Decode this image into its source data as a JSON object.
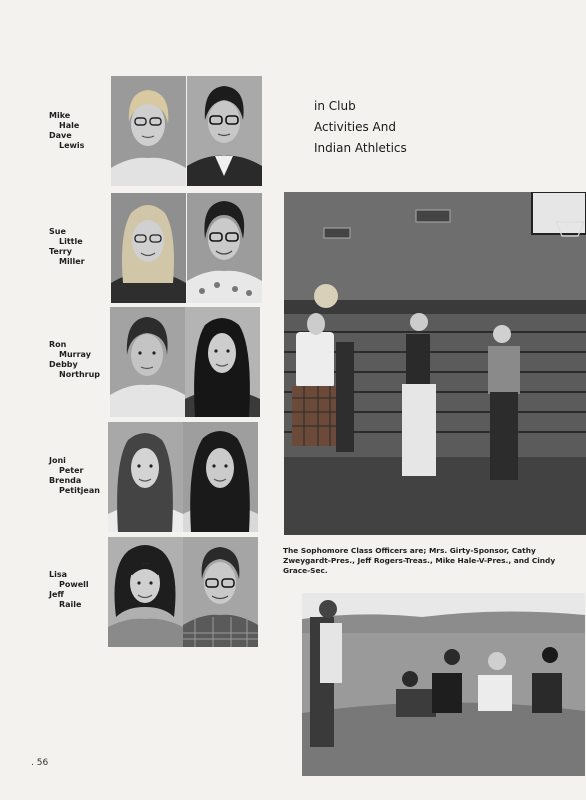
{
  "heading": {
    "line1": "in Club",
    "line2": "Activities And",
    "line3": "Indian Athletics"
  },
  "students": [
    {
      "row": 1,
      "first_a": "Mike",
      "last_a": "Hale",
      "first_b": "Dave",
      "last_b": "Lewis"
    },
    {
      "row": 2,
      "first_a": "Sue",
      "last_a": "Little",
      "first_b": "Terry",
      "last_b": "Miller"
    },
    {
      "row": 3,
      "first_a": "Ron",
      "last_a": "Murray",
      "first_b": "Debby",
      "last_b": "Northrup"
    },
    {
      "row": 4,
      "first_a": "Joni",
      "last_a": "Peter",
      "first_b": "Brenda",
      "last_b": "Petitjean"
    },
    {
      "row": 5,
      "first_a": "Lisa",
      "last_a": "Powell",
      "first_b": "Jeff",
      "last_b": "Raile"
    }
  ],
  "caption": "The Sophomore Class Officers are; Mrs. Girty-Sponsor, Cathy Zweygardt-Pres., Jeff Rogers-Treas., Mike Hale-V-Pres., and Cindy Grace-Sec.",
  "page_number": "56"
}
